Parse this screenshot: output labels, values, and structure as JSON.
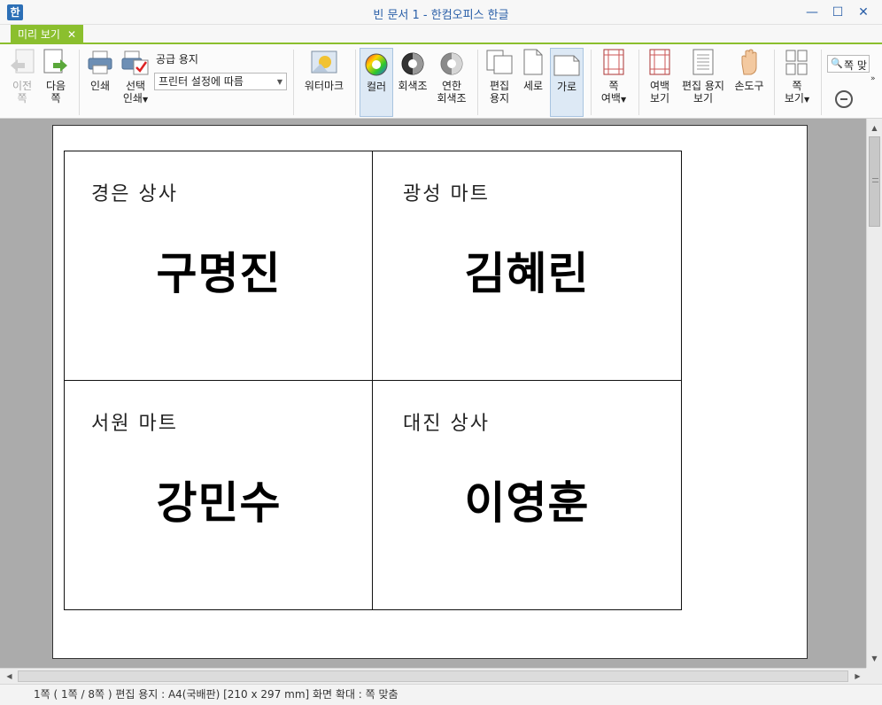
{
  "window": {
    "title": "빈 문서 1 - 한컴오피스 한글",
    "icon_name": "hancom-app-icon",
    "minimize_symbol": "—",
    "maximize_symbol": "☐",
    "close_symbol": "✕"
  },
  "tab": {
    "label": "미리 보기",
    "close_symbol": "✕",
    "accent_color": "#8bbf2e"
  },
  "ribbon": {
    "prev_page": {
      "line1": "이전",
      "line2": "쪽",
      "disabled": true
    },
    "next_page": {
      "line1": "다음",
      "line2": "쪽"
    },
    "print": {
      "label": "인쇄"
    },
    "select_print": {
      "line1": "선택",
      "line2": "인쇄"
    },
    "paper": {
      "label": "공급 용지",
      "selected": "프린터 설정에 따름"
    },
    "watermark": {
      "label": "워터마크"
    },
    "color": {
      "label": "컬러",
      "active": true
    },
    "grayscale": {
      "label": "회색조"
    },
    "light_grayscale": {
      "line1": "연한",
      "line2": "회색조"
    },
    "edit_paper": {
      "line1": "편집",
      "line2": "용지"
    },
    "portrait": {
      "label": "세로"
    },
    "landscape": {
      "label": "가로",
      "active": true
    },
    "page_margin": {
      "line1": "쪽",
      "line2": "여백"
    },
    "margin_view": {
      "line1": "여백",
      "line2": "보기"
    },
    "edit_paper_view": {
      "line1": "편집 용지",
      "line2": "보기"
    },
    "hand_tool": {
      "label": "손도구"
    },
    "page_view": {
      "line1": "쪽",
      "line2": "보기"
    },
    "zoom": {
      "value": "쪽 맞"
    }
  },
  "document": {
    "labels": [
      {
        "company": "경은 상사",
        "name": "구명진"
      },
      {
        "company": "광성 마트",
        "name": "김혜린"
      },
      {
        "company": "서원 마트",
        "name": "강민수"
      },
      {
        "company": "대진 상사",
        "name": "이영훈"
      }
    ]
  },
  "status": {
    "text": "1쪽 ( 1쪽 / 8쪽 ) 편집 용지 : A4(국배판) [210 x 297 mm]  화면 확대 : 쪽 맞춤"
  }
}
